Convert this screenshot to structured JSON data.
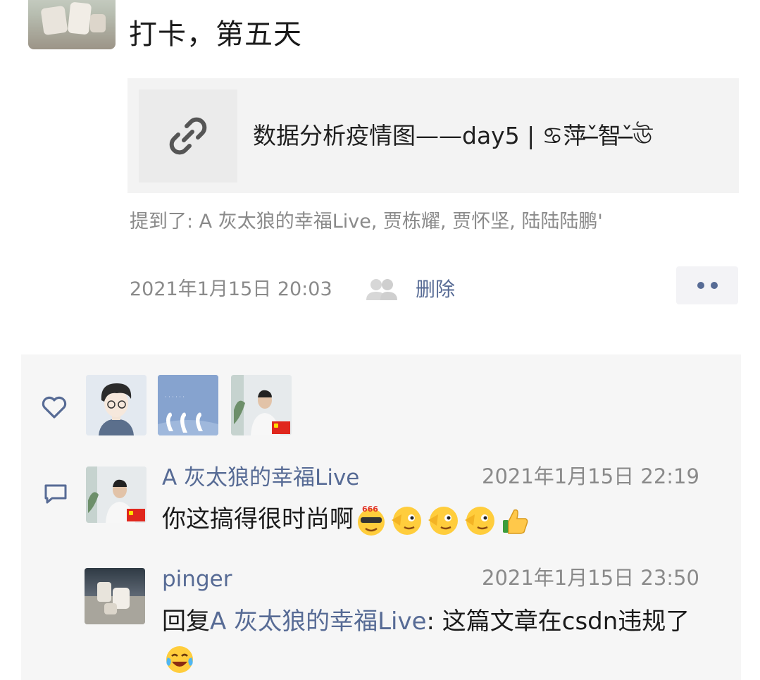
{
  "post": {
    "text": "打卡，第五天",
    "link_title": "数据分析疫情图——day5 | ♋萍ˇ̶智ˇ̶ঊ",
    "mentions": "提到了:  A 灰太狼的幸福Live, 贾栋耀, 贾怀坚, 陆陆陆鹏'",
    "time": "2021年1月15日 20:03",
    "delete_label": "删除"
  },
  "likes": {
    "icon": "heart-icon",
    "count": 3
  },
  "comments": [
    {
      "name": "A 灰太狼的幸福Live",
      "time": "2021年1月15日 22:19",
      "text": "你这搞得很时尚啊",
      "emojis": [
        "666-cool-emoji",
        "wink-emoji",
        "wink-emoji",
        "wink-emoji",
        "thumbs-up-emoji"
      ]
    },
    {
      "name": "pinger",
      "time": "2021年1月15日 23:50",
      "reply_prefix": "回复",
      "reply_to": "A 灰太狼的幸福Live",
      "text": ": 这篇文章在csdn违规了",
      "emojis": [
        "laugh-cry-emoji"
      ]
    }
  ],
  "colors": {
    "link": "#576b95",
    "meta": "#8a8a8a",
    "panel_bg": "#f6f6f6",
    "card_bg": "#f3f3f3"
  }
}
